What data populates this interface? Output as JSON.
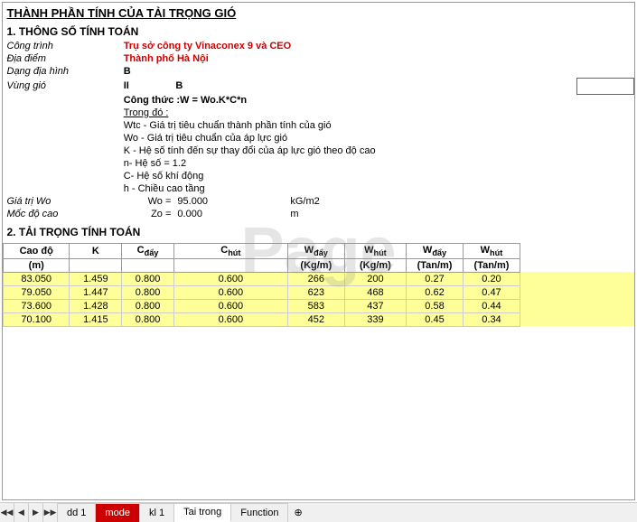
{
  "title": "THÀNH PHẦN TÍNH CỦA TẢI TRỌNG GIÓ",
  "section1": {
    "label": "1. THÔNG SỐ TÍNH TOÁN",
    "fields": {
      "cong_trinh_label": "Công trình",
      "cong_trinh_value": "Trụ sở công ty  Vinaconex 9 và CEO",
      "dia_diem_label": "Địa điểm",
      "dia_diem_value": "Thành phố  Hà Nội",
      "dang_dia_hinh_label": "Dạng địa hình",
      "dang_dia_hinh_value": "B",
      "vung_gio_label": "Vùng gió",
      "vung_gio_value1": "II",
      "vung_gio_value2": "B"
    },
    "formula": {
      "label": "Công thức :W = Wo.K*C*n",
      "trong_do": "Trong đó :",
      "line1": "Wtc - Giá trị tiêu chuẩn thành phần tính của gió",
      "line2": "Wo - Giá trị  tiêu chuẩn của áp lực gió",
      "line3": "K - Hệ số tính đến sự thay đổi của áp lực gió theo độ cao",
      "line4": "n- Hệ số = 1.2",
      "line5": "C- Hệ số khí động",
      "line6": "h - Chiều cao tầng"
    },
    "wo": {
      "label": "Giá trị Wo",
      "wo_eq": "Wo =",
      "wo_val": "95.000",
      "wo_unit": "kG/m2",
      "label2": "Mốc độ cao",
      "zo_eq": "Zo =",
      "zo_val": "0.000",
      "zo_unit": "m"
    }
  },
  "section2": {
    "label": "2. TẢI TRỌNG TÍNH TOÁN",
    "table": {
      "headers": [
        "Cao độ",
        "K",
        "Cđây",
        "Chút",
        "Wđây",
        "Whút",
        "Wđây",
        "Whút"
      ],
      "subheaders": [
        "(m)",
        "",
        "",
        "",
        "(Kg/m)",
        "(Kg/m)",
        "(Tan/m)",
        "(Tan/m)"
      ],
      "rows": [
        {
          "cao_do": "83.050",
          "k": "1.459",
          "c_day": "0.800",
          "c_hut": "0.600",
          "w_day": "266",
          "w_hut": "200",
          "wd_tan": "0.27",
          "wh_tan": "0.20",
          "yellow": true
        },
        {
          "cao_do": "79.050",
          "k": "1.447",
          "c_day": "0.800",
          "c_hut": "0.600",
          "w_day": "623",
          "w_hut": "468",
          "wd_tan": "0.62",
          "wh_tan": "0.47",
          "yellow": true
        },
        {
          "cao_do": "73.600",
          "k": "1.428",
          "c_day": "0.800",
          "c_hut": "0.600",
          "w_day": "583",
          "w_hut": "437",
          "wd_tan": "0.58",
          "wh_tan": "0.44",
          "yellow": true
        },
        {
          "cao_do": "70.100",
          "k": "1.415",
          "c_day": "0.800",
          "c_hut": "0.600",
          "w_day": "452",
          "w_hut": "339",
          "wd_tan": "0.45",
          "wh_tan": "0.34",
          "yellow": true
        }
      ]
    }
  },
  "tabs": [
    {
      "id": "dd1",
      "label": "dd 1",
      "type": "normal"
    },
    {
      "id": "mode",
      "label": "mode",
      "type": "red"
    },
    {
      "id": "kl1",
      "label": "kl 1",
      "type": "normal"
    },
    {
      "id": "taitrong",
      "label": "Tai trong",
      "type": "active"
    },
    {
      "id": "function",
      "label": "Function",
      "type": "normal"
    }
  ],
  "watermark": "Page"
}
